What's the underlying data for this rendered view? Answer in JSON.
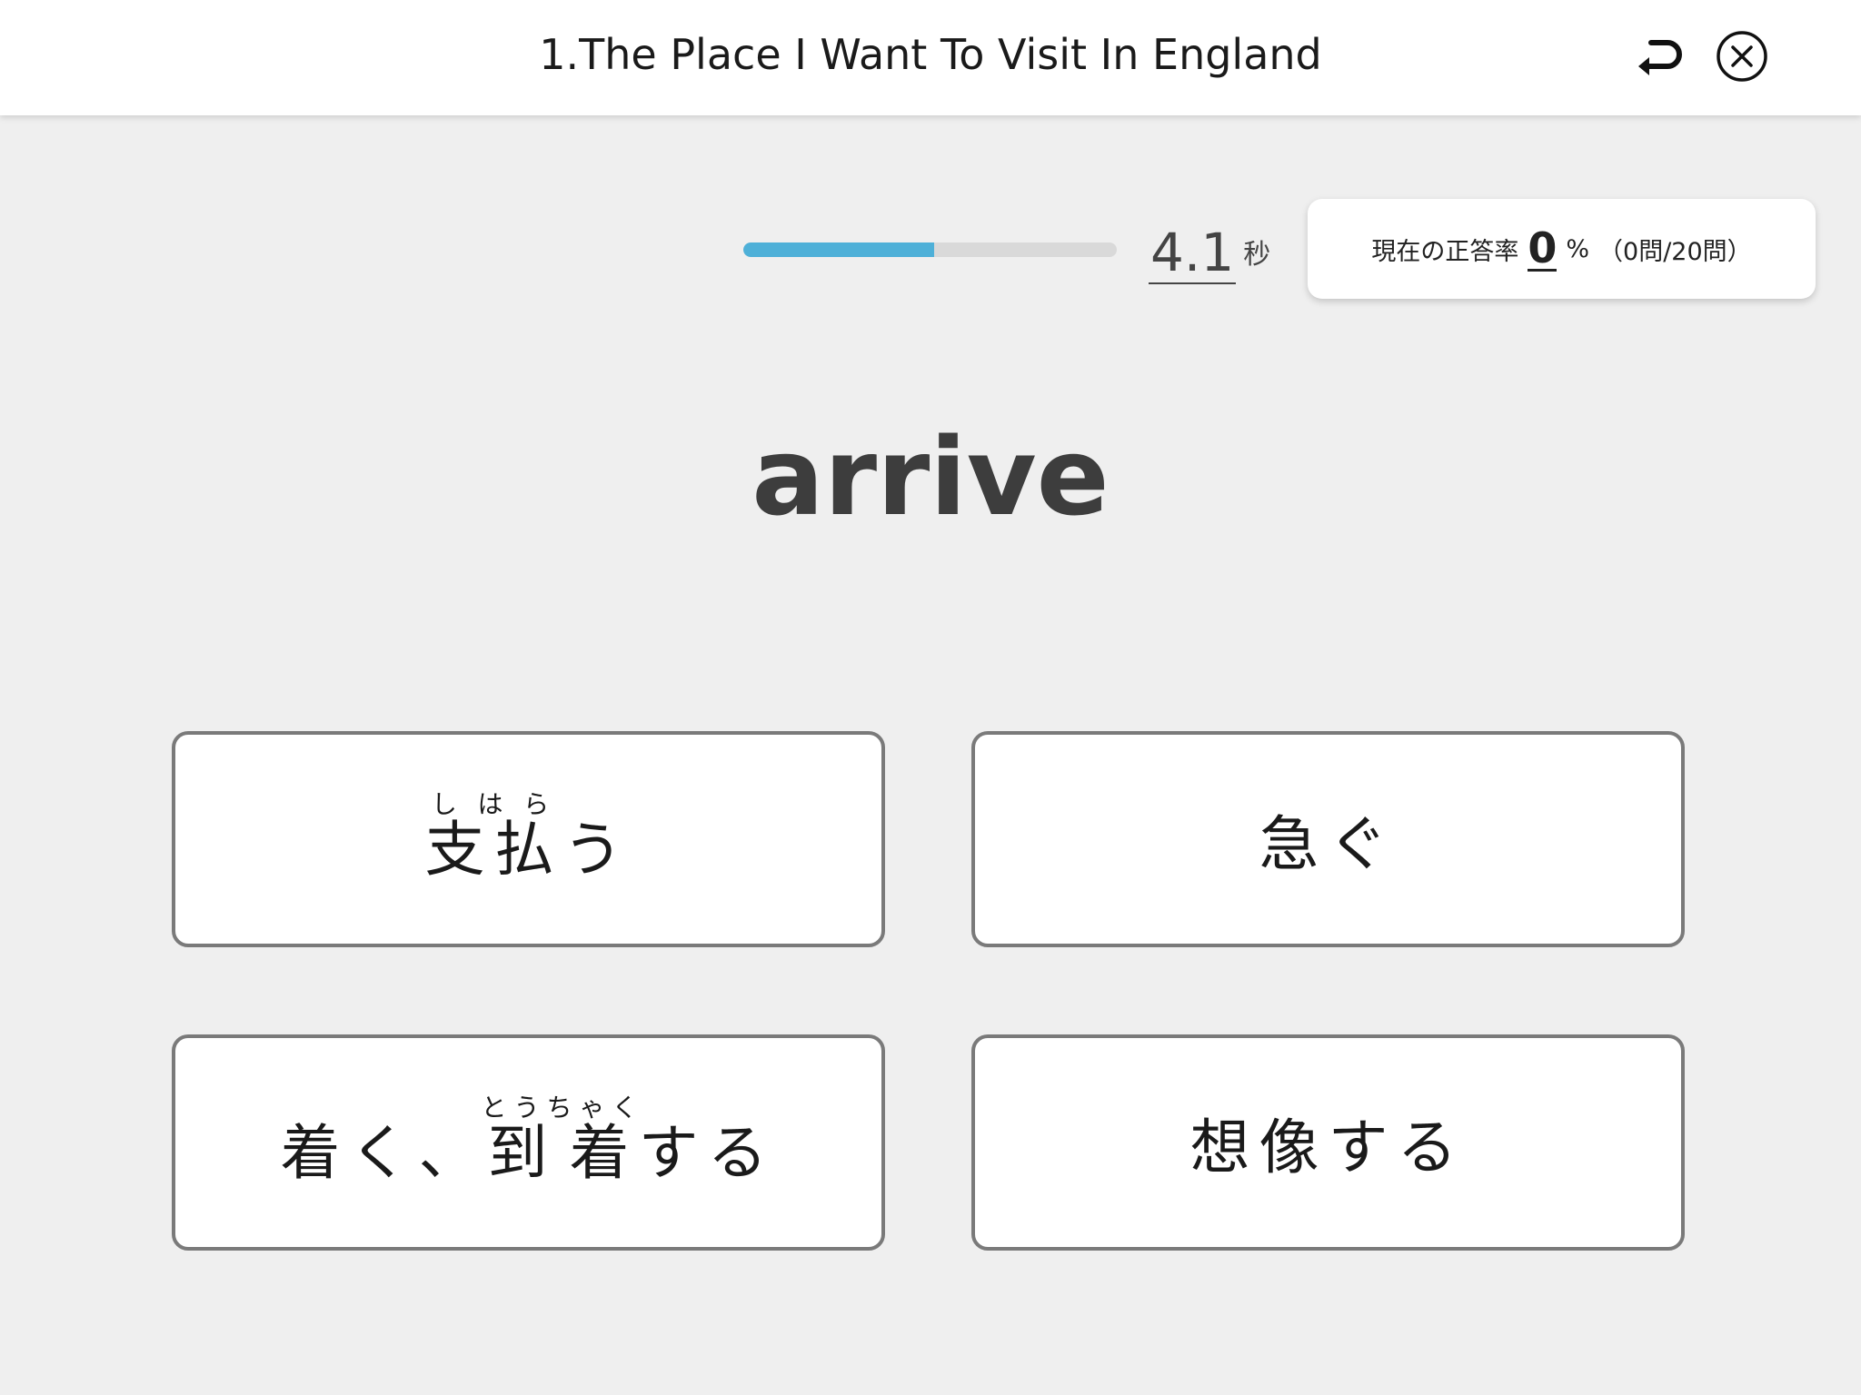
{
  "header": {
    "title": "1.The Place I Want To Visit In England",
    "back_icon": "return-arrow-icon",
    "close_icon": "close-circle-icon"
  },
  "timer": {
    "progress": 0.51,
    "value": "4.1",
    "unit": "秒",
    "fill_color": "#4eb0d8"
  },
  "score": {
    "label": "現在の正答率",
    "value": "0",
    "unit": "%",
    "count": "（0問/20問）"
  },
  "question": {
    "word": "arrive"
  },
  "choices": [
    {
      "parts": [
        {
          "base": "支払",
          "ruby": "しはら"
        },
        {
          "text": "う"
        }
      ]
    },
    {
      "parts": [
        {
          "text": "急ぐ"
        }
      ]
    },
    {
      "parts": [
        {
          "text": "着く、"
        },
        {
          "base": "到着",
          "ruby": "とうちゃく"
        },
        {
          "text": "する"
        }
      ]
    },
    {
      "parts": [
        {
          "text": "想像する"
        }
      ]
    }
  ]
}
